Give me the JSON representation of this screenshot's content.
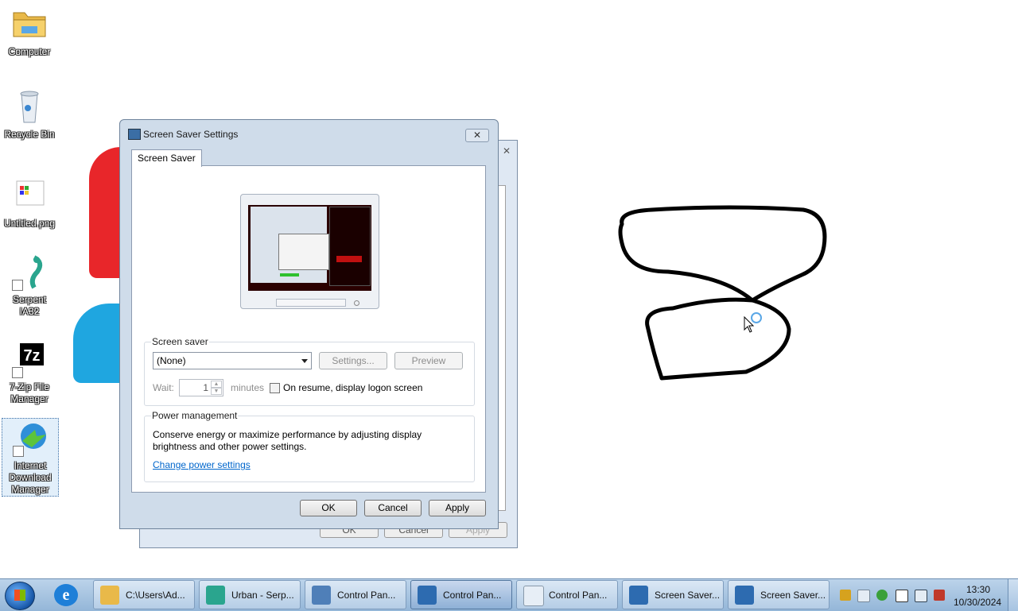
{
  "desktop": {
    "icons": [
      {
        "label": "Computer",
        "icon": "folder-icon"
      },
      {
        "label": "Recycle Bin",
        "icon": "recycle-bin-icon"
      },
      {
        "label": "Untitled.png",
        "icon": "image-file-icon"
      },
      {
        "label": "Serpent IA32",
        "icon": "serpent-icon"
      },
      {
        "label": "7-Zip File Manager",
        "icon": "7zip-icon",
        "glyph": "7z"
      },
      {
        "label": "Internet Download Manager",
        "icon": "idm-icon"
      }
    ]
  },
  "dialog": {
    "title": "Screen Saver Settings",
    "close_glyph": "✕",
    "tab": "Screen Saver",
    "screen_saver_group": "Screen saver",
    "screen_saver_value": "(None)",
    "settings_button": "Settings...",
    "preview_button": "Preview",
    "wait_label": "Wait:",
    "wait_value": "1",
    "minutes_label": "minutes",
    "resume_checkbox_label": "On resume, display logon screen",
    "resume_checked": false,
    "power_group": "Power management",
    "power_text": "Conserve energy or maximize performance by adjusting display brightness and other power settings.",
    "power_link": "Change power settings",
    "ok_button": "OK",
    "cancel_button": "Cancel",
    "apply_button": "Apply"
  },
  "back_dialog": {
    "ok_button": "OK",
    "cancel_button": "Cancel",
    "apply_button": "Apply",
    "close_glyph": "✕"
  },
  "taskbar": {
    "tasks": [
      {
        "label": "C:\\Users\\Ad...",
        "icon": "folder-icon",
        "active": false
      },
      {
        "label": "Urban - Serp...",
        "icon": "serpent-icon",
        "active": false
      },
      {
        "label": "Control Pan...",
        "icon": "control-panel-icon",
        "active": false
      },
      {
        "label": "Control Pan...",
        "icon": "display-icon",
        "active": true
      },
      {
        "label": "Control Pan...",
        "icon": "document-icon",
        "active": false
      },
      {
        "label": "Screen Saver...",
        "icon": "display-icon",
        "active": false
      },
      {
        "label": "Screen Saver...",
        "icon": "display-icon",
        "active": false
      }
    ],
    "clock_time": "13:30",
    "clock_date": "10/30/2024",
    "tray_icons": [
      "network-icon",
      "document-icon",
      "security-icon",
      "flag-icon",
      "display-icon",
      "volume-muted-icon"
    ]
  },
  "colors": {
    "accent": "#3b6ea5",
    "link": "#0066cc",
    "paint_red": "#e8262a",
    "paint_blue": "#1fa6e0"
  }
}
